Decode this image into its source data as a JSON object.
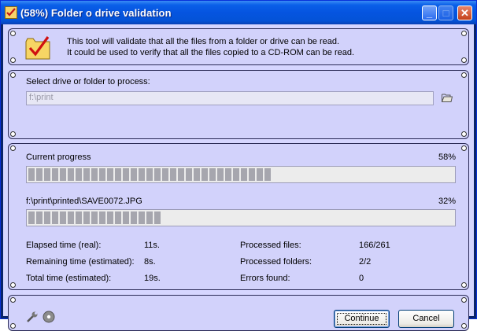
{
  "window": {
    "title": "(58%) Folder o drive validation"
  },
  "intro": {
    "line1": "This tool will validate that all the files from a folder or drive can be read.",
    "line2": "It could be used to verify that all the files copied to a CD-ROM can be read."
  },
  "source": {
    "label": "Select drive or folder to process:",
    "value": "f:\\print"
  },
  "progress": {
    "current_label": "Current progress",
    "current_percent_text": "58%",
    "current_fraction": 0.58,
    "file_label": "f:\\print\\printed\\SAVE0072.JPG",
    "file_percent_text": "32%",
    "file_fraction": 0.32
  },
  "stats": {
    "elapsed_label": "Elapsed time (real):",
    "elapsed_value": "11s.",
    "remaining_label": "Remaining time (estimated):",
    "remaining_value": "8s.",
    "total_label": "Total time (estimated):",
    "total_value": "19s.",
    "files_label": "Processed files:",
    "files_value": "166/261",
    "folders_label": "Processed folders:",
    "folders_value": "2/2",
    "errors_label": "Errors found:",
    "errors_value": "0"
  },
  "buttons": {
    "continue": "Continue",
    "cancel": "Cancel"
  },
  "icons": {
    "app": "checklist-icon",
    "browse": "folder-open-icon",
    "tools": "wrench-icon",
    "disc": "cd-icon"
  }
}
